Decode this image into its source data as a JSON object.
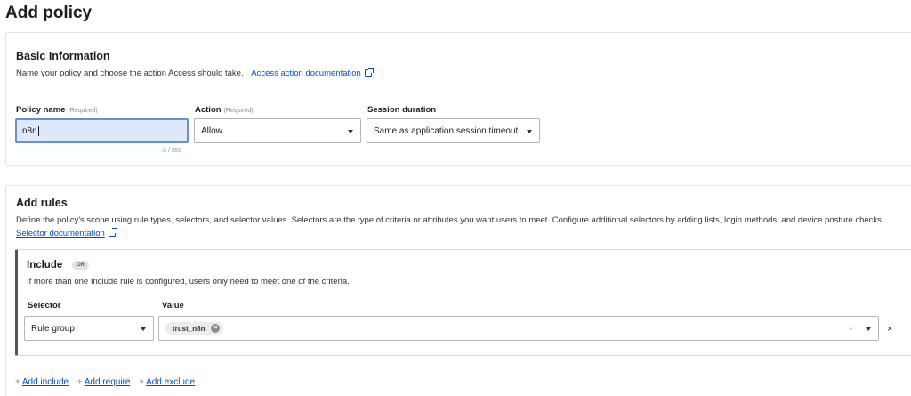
{
  "page": {
    "title": "Add policy"
  },
  "basic": {
    "title": "Basic Information",
    "desc": "Name your policy and choose the action Access should take.",
    "doc_link": "Access action documentation",
    "policy_name": {
      "label": "Policy name",
      "req": "(Required)",
      "value": "n8n",
      "counter": "3 / 350"
    },
    "action": {
      "label": "Action",
      "req": "(Required)",
      "value": "Allow"
    },
    "session": {
      "label": "Session duration",
      "value": "Same as application session timeout"
    }
  },
  "rules": {
    "title": "Add rules",
    "desc": "Define the policy's scope using rule types, selectors, and selector values. Selectors are the type of criteria or attributes you want users to meet. Configure additional selectors by adding lists, login methods, and device posture checks.",
    "doc_link": "Selector documentation",
    "include": {
      "title": "Include",
      "badge": "OR",
      "desc": "If more than one Include rule is configured, users only need to meet one of the criteria.",
      "selector_label": "Selector",
      "value_label": "Value",
      "selector_value": "Rule group",
      "chip": "trust_n8n",
      "clear": "×",
      "remove": "×"
    },
    "links": {
      "plus": "+",
      "add_include": "Add include",
      "add_require": "Add require",
      "add_exclude": "Add exclude"
    }
  }
}
